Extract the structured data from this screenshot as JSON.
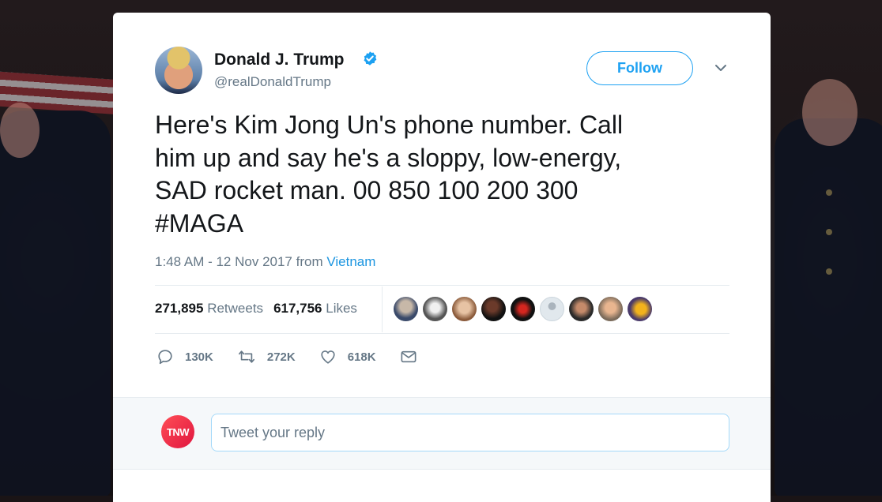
{
  "tweet": {
    "author_name": "Donald J. Trump",
    "handle": "@realDonaldTrump",
    "follow_label": "Follow",
    "text": "Here's Kim Jong Un's phone number. Call\nhim up and say he's a sloppy, low-energy,\nSAD rocket man. 00 850 100 200 300\n#MAGA",
    "time_text": "1:48 AM - 12 Nov 2017 from ",
    "location": "Vietnam"
  },
  "stats": {
    "retweets_count": "271,895",
    "retweets_label": "Retweets",
    "likes_count": "617,756",
    "likes_label": "Likes"
  },
  "actions": {
    "replies": "130K",
    "retweets": "272K",
    "likes": "618K"
  },
  "reply": {
    "avatar_text": "TNW",
    "placeholder": "Tweet your reply"
  },
  "colors": {
    "accent": "#1da1f2",
    "secondary_text": "#657786",
    "primary_text": "#14171a"
  }
}
